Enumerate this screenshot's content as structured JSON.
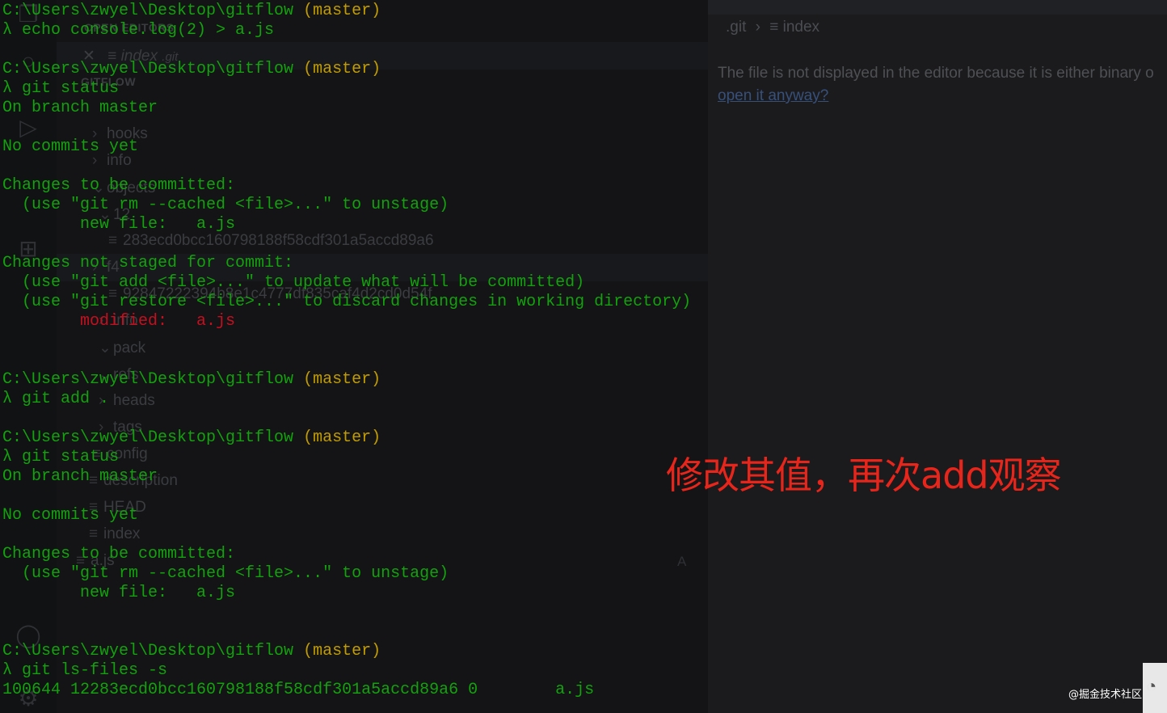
{
  "vscode": {
    "activity_icons": [
      "files-icon",
      "search-icon",
      "run-debug-icon",
      "extensions-icon",
      "account-icon",
      "settings-icon"
    ],
    "explorer": {
      "open_editors_header": "OPEN EDITORS",
      "open_editor_item": "index",
      "open_editor_item_folder": ".git",
      "gitflow_header": "GITFLOW",
      "tree": [
        {
          "label": "hooks",
          "caret": "›"
        },
        {
          "label": "info",
          "caret": "›"
        },
        {
          "label": "objects",
          "caret": "⌄"
        },
        {
          "label": "12",
          "caret": "⌄"
        },
        {
          "label": "283ecd0bcc160798188f58cdf301a5accd89a6",
          "caret": ""
        },
        {
          "label": "f4",
          "caret": "›"
        },
        {
          "label": "92847222394b8e1c4777df835caf4d2cd0d54f",
          "caret": ""
        },
        {
          "label": "info",
          "caret": "›"
        },
        {
          "label": "pack",
          "caret": "⌄"
        },
        {
          "label": "refs",
          "caret": "⌄"
        },
        {
          "label": "heads",
          "caret": "›"
        },
        {
          "label": "tags",
          "caret": "›"
        },
        {
          "label": "config",
          "caret": ""
        },
        {
          "label": "description",
          "caret": ""
        },
        {
          "label": "HEAD",
          "caret": ""
        },
        {
          "label": "index",
          "caret": ""
        },
        {
          "label": "a.js",
          "caret": ""
        }
      ]
    },
    "editor": {
      "breadcrumb_folder": ".git",
      "breadcrumb_file": "index",
      "message": "The file is not displayed in the editor because it is either binary o",
      "link": "open it anyway?",
      "ghost_letter": "A"
    }
  },
  "terminal": {
    "lines": [
      {
        "segments": [
          {
            "t": "C:\\Users\\zwyel\\Desktop\\gitflow ",
            "c": "green"
          },
          {
            "t": "(master)",
            "c": "yellow"
          }
        ]
      },
      {
        "segments": [
          {
            "t": "λ echo console.log(2) > a.js",
            "c": "green"
          }
        ]
      },
      {
        "segments": []
      },
      {
        "segments": [
          {
            "t": "C:\\Users\\zwyel\\Desktop\\gitflow ",
            "c": "green"
          },
          {
            "t": "(master)",
            "c": "yellow"
          }
        ]
      },
      {
        "segments": [
          {
            "t": "λ git status",
            "c": "green"
          }
        ]
      },
      {
        "segments": [
          {
            "t": "On branch master",
            "c": "green"
          }
        ]
      },
      {
        "segments": []
      },
      {
        "segments": [
          {
            "t": "No commits yet",
            "c": "green"
          }
        ]
      },
      {
        "segments": []
      },
      {
        "segments": [
          {
            "t": "Changes to be committed:",
            "c": "green"
          }
        ]
      },
      {
        "segments": [
          {
            "t": "  (use \"git rm --cached <file>...\" to unstage)",
            "c": "green"
          }
        ]
      },
      {
        "segments": [
          {
            "t": "        new file:   a.js",
            "c": "green"
          }
        ]
      },
      {
        "segments": []
      },
      {
        "segments": [
          {
            "t": "Changes not staged for commit:",
            "c": "green"
          }
        ]
      },
      {
        "segments": [
          {
            "t": "  (use \"git add <file>...\" to update what will be committed)",
            "c": "green"
          }
        ]
      },
      {
        "segments": [
          {
            "t": "  (use \"git restore <file>...\" to discard changes in working directory)",
            "c": "green"
          }
        ]
      },
      {
        "segments": [
          {
            "t": "        modified:   a.js",
            "c": "red"
          }
        ]
      },
      {
        "segments": []
      },
      {
        "segments": []
      },
      {
        "segments": [
          {
            "t": "C:\\Users\\zwyel\\Desktop\\gitflow ",
            "c": "green"
          },
          {
            "t": "(master)",
            "c": "yellow"
          }
        ]
      },
      {
        "segments": [
          {
            "t": "λ git add .",
            "c": "green"
          }
        ]
      },
      {
        "segments": []
      },
      {
        "segments": [
          {
            "t": "C:\\Users\\zwyel\\Desktop\\gitflow ",
            "c": "green"
          },
          {
            "t": "(master)",
            "c": "yellow"
          }
        ]
      },
      {
        "segments": [
          {
            "t": "λ git status",
            "c": "green"
          }
        ]
      },
      {
        "segments": [
          {
            "t": "On branch master",
            "c": "green"
          }
        ]
      },
      {
        "segments": []
      },
      {
        "segments": [
          {
            "t": "No commits yet",
            "c": "green"
          }
        ]
      },
      {
        "segments": []
      },
      {
        "segments": [
          {
            "t": "Changes to be committed:",
            "c": "green"
          }
        ]
      },
      {
        "segments": [
          {
            "t": "  (use \"git rm --cached <file>...\" to unstage)",
            "c": "green"
          }
        ]
      },
      {
        "segments": [
          {
            "t": "        new file:   a.js",
            "c": "green"
          }
        ]
      },
      {
        "segments": []
      },
      {
        "segments": []
      },
      {
        "segments": [
          {
            "t": "C:\\Users\\zwyel\\Desktop\\gitflow ",
            "c": "green"
          },
          {
            "t": "(master)",
            "c": "yellow"
          }
        ]
      },
      {
        "segments": [
          {
            "t": "λ git ls-files -s",
            "c": "green"
          }
        ]
      },
      {
        "segments": [
          {
            "t": "100644 12283ecd0bcc160798188f58cdf301a5accd89a6 0\ta.js",
            "c": "green"
          }
        ]
      }
    ]
  },
  "annotation": "修改其值，再次add观察",
  "watermark": "@掘金技术社区",
  "colors": {
    "terminal_green": "#13a10e",
    "terminal_yellow": "#c19c00",
    "terminal_red": "#c50f1f",
    "annotation_red": "#e8251b"
  }
}
